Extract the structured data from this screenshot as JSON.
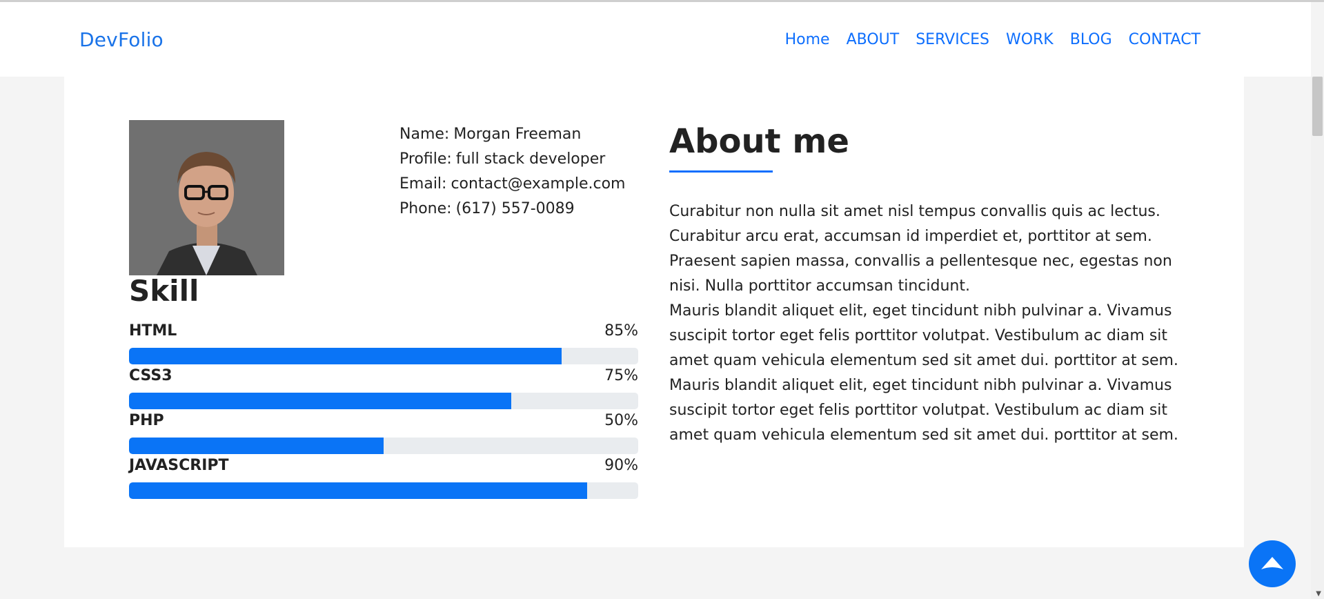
{
  "navbar": {
    "brand": "DevFolio",
    "links": [
      "Home",
      "ABOUT",
      "SERVICES",
      "WORK",
      "BLOG",
      "CONTACT"
    ]
  },
  "profile": {
    "name_label": "Name:",
    "name": "Morgan Freeman",
    "profile_label": "Profile:",
    "profile": "full stack developer",
    "email_label": "Email:",
    "email": "contact@example.com",
    "phone_label": "Phone:",
    "phone": "(617) 557-0089"
  },
  "skills": {
    "title": "Skill",
    "items": [
      {
        "name": "HTML",
        "percent": "85%",
        "value": 85
      },
      {
        "name": "CSS3",
        "percent": "75%",
        "value": 75
      },
      {
        "name": "PHP",
        "percent": "50%",
        "value": 50
      },
      {
        "name": "JAVASCRIPT",
        "percent": "90%",
        "value": 90
      }
    ]
  },
  "about": {
    "title": "About me",
    "paragraphs": [
      "Curabitur non nulla sit amet nisl tempus convallis quis ac lectus. Curabitur arcu erat, accumsan id imperdiet et, porttitor at sem. Praesent sapien massa, convallis a pellentesque nec, egestas non nisi. Nulla porttitor accumsan tincidunt.",
      "Mauris blandit aliquet elit, eget tincidunt nibh pulvinar a. Vivamus suscipit tortor eget felis porttitor volutpat. Vestibulum ac diam sit amet quam vehicula elementum sed sit amet dui. porttitor at sem.",
      "Mauris blandit aliquet elit, eget tincidunt nibh pulvinar a. Vivamus suscipit tortor eget felis porttitor volutpat. Vestibulum ac diam sit amet quam vehicula elementum sed sit amet dui. porttitor at sem."
    ]
  },
  "colors": {
    "accent": "#0d6efd",
    "progress_fill": "#0a74f6",
    "progress_track": "#e9ecef"
  },
  "icons": {
    "back_to_top": "chevron-up-icon"
  }
}
